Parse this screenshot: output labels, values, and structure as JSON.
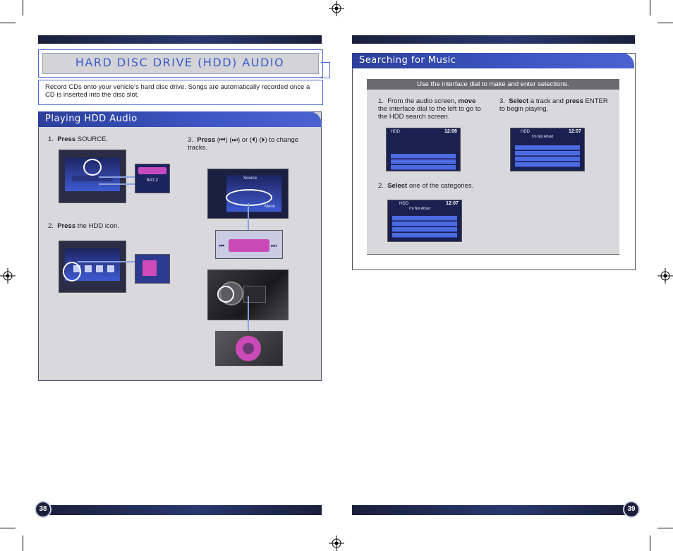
{
  "left_page": {
    "page_number": "38",
    "title": "HARD DISC DRIVE (HDD) AUDIO",
    "intro": "Record CDs onto your vehicle’s hard disc drive. Songs are automatically recorded once a CD is inserted into the disc slot.",
    "section_title": "Playing HDD Audio",
    "steps": [
      {
        "num": "1.",
        "verb": "Press",
        "text": " SOURCE."
      },
      {
        "num": "2.",
        "verb": "Press",
        "text": " the HDD icon."
      },
      {
        "num": "3.",
        "verb": "Press",
        "text": " (⏮) (⏭) or (⏴) (⏵) to change tracks."
      }
    ]
  },
  "right_page": {
    "page_number": "39",
    "section_title": "Searching for Music",
    "instruction_bar": "Use the interface dial to make and enter selections.",
    "steps": [
      {
        "num": "1.",
        "pre": "From the audio screen, ",
        "verb": "move",
        "text": " the interface dial to the left to go to the HDD search screen."
      },
      {
        "num": "2.",
        "verb": "Select",
        "text": " one of the categories."
      },
      {
        "num": "3.",
        "verb": "Select",
        "text": " a track and ",
        "verb2": "press",
        "text2": " ENTER to begin playing."
      }
    ]
  },
  "screens": {
    "hdd_label": "HDD",
    "time_1": "12:06",
    "time_2": "12:07",
    "time_3": "12:07",
    "track_name": "I'm Not Afraid",
    "source_label": "Source",
    "menu_label": "Menu",
    "preset_label": "BAT-2"
  }
}
